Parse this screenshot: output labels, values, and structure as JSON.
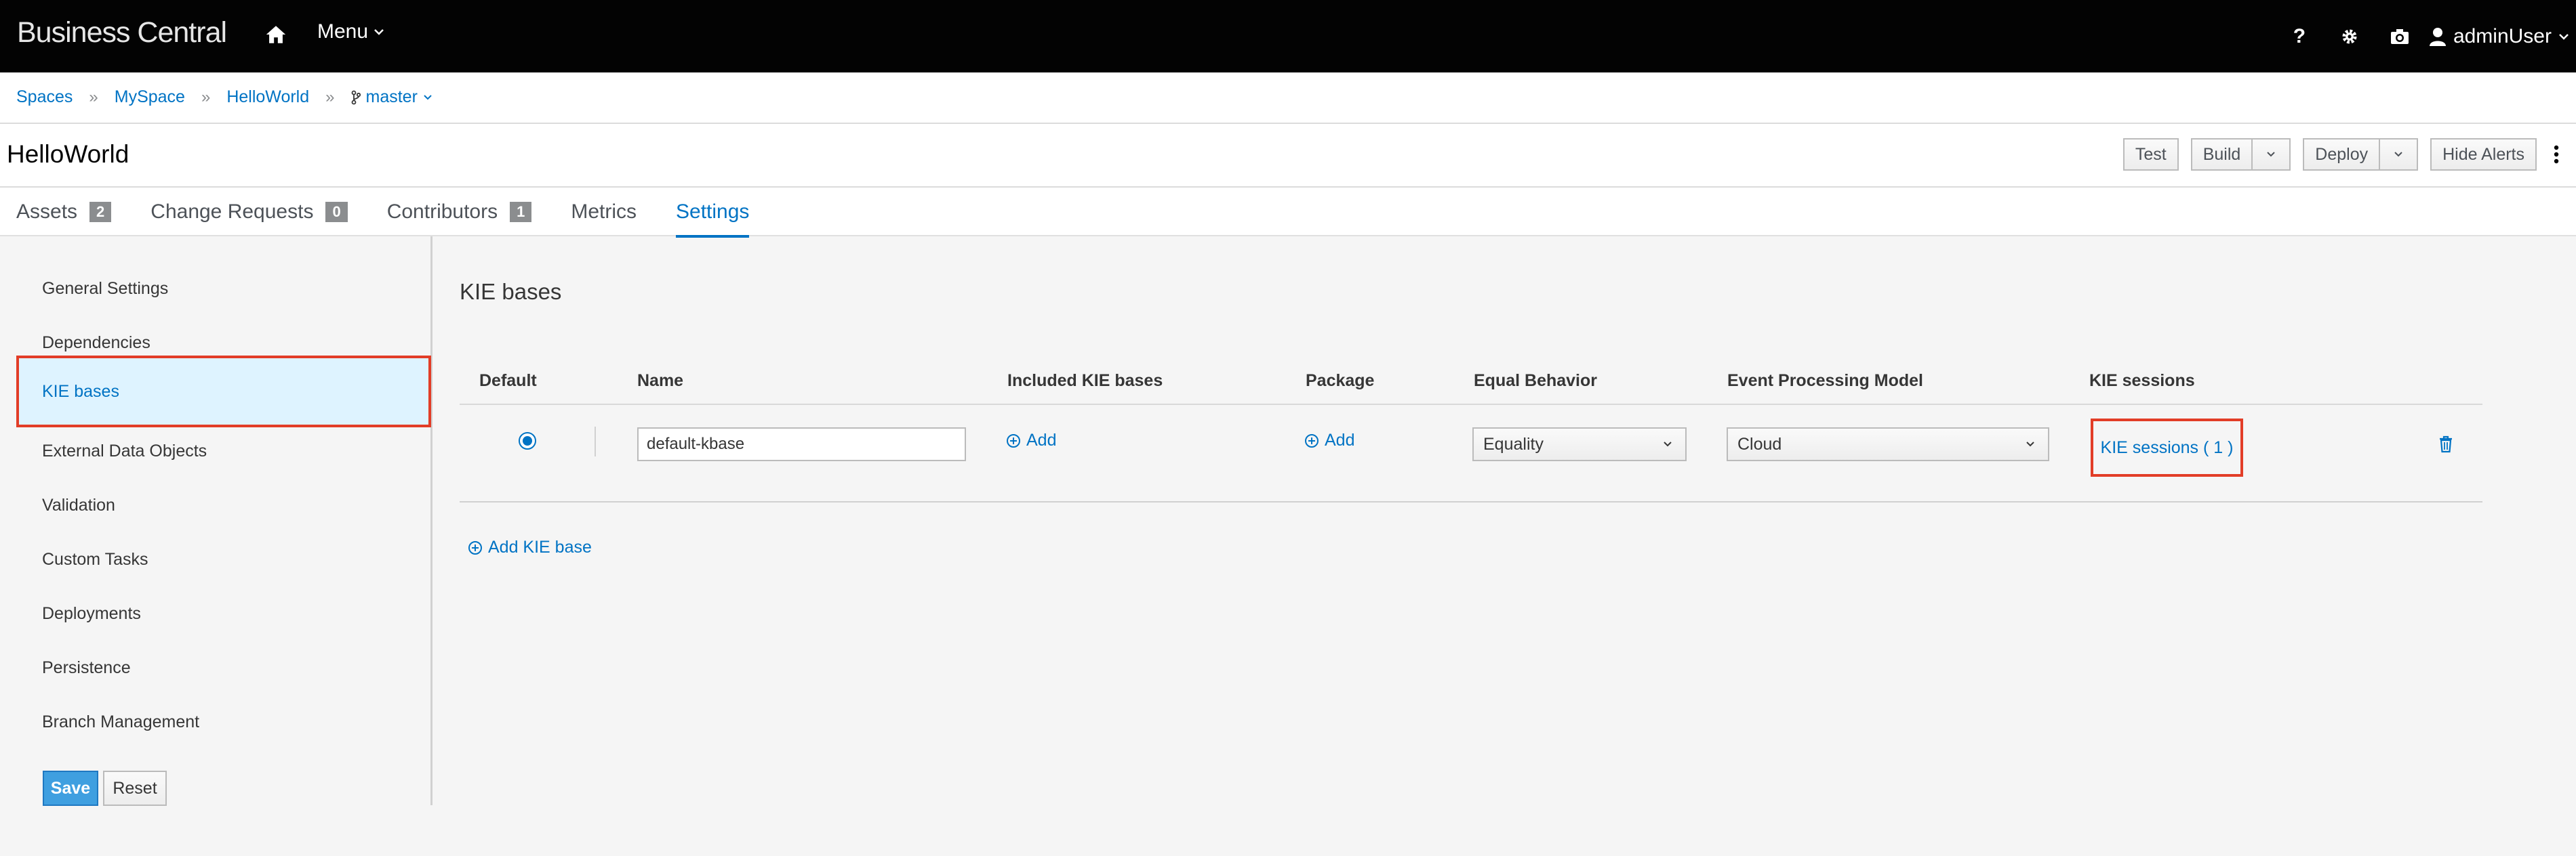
{
  "topbar": {
    "brand": "Business Central",
    "menu_label": "Menu",
    "user_label": "adminUser"
  },
  "breadcrumb": {
    "items": [
      "Spaces",
      "MySpace",
      "HelloWorld"
    ],
    "branch": "master"
  },
  "title": "HelloWorld",
  "toolbar": {
    "test": "Test",
    "build": "Build",
    "deploy": "Deploy",
    "hide_alerts": "Hide Alerts"
  },
  "tabs": [
    {
      "label": "Assets",
      "count": "2"
    },
    {
      "label": "Change Requests",
      "count": "0"
    },
    {
      "label": "Contributors",
      "count": "1"
    },
    {
      "label": "Metrics"
    },
    {
      "label": "Settings"
    }
  ],
  "sidenav": {
    "items": [
      "General Settings",
      "Dependencies",
      "KIE bases",
      "External Data Objects",
      "Validation",
      "Custom Tasks",
      "Deployments",
      "Persistence",
      "Branch Management"
    ],
    "active": "KIE bases",
    "save": "Save",
    "reset": "Reset"
  },
  "main": {
    "section_title": "KIE bases",
    "headers": [
      "Default",
      "Name",
      "Included KIE bases",
      "Package",
      "Equal Behavior",
      "Event Processing Model",
      "KIE sessions"
    ],
    "row": {
      "default_selected": true,
      "name": "default-kbase",
      "included_add": "Add",
      "package_add": "Add",
      "equal_behavior": "Equality",
      "event_processing": "Cloud",
      "kie_sessions": "KIE sessions ( 1 )"
    },
    "add_kbase": "Add KIE base"
  },
  "colors": {
    "accent": "#0073c4",
    "highlight": "#e23d27",
    "topbar": "#030303",
    "active_nav_bg": "#def3ff"
  }
}
